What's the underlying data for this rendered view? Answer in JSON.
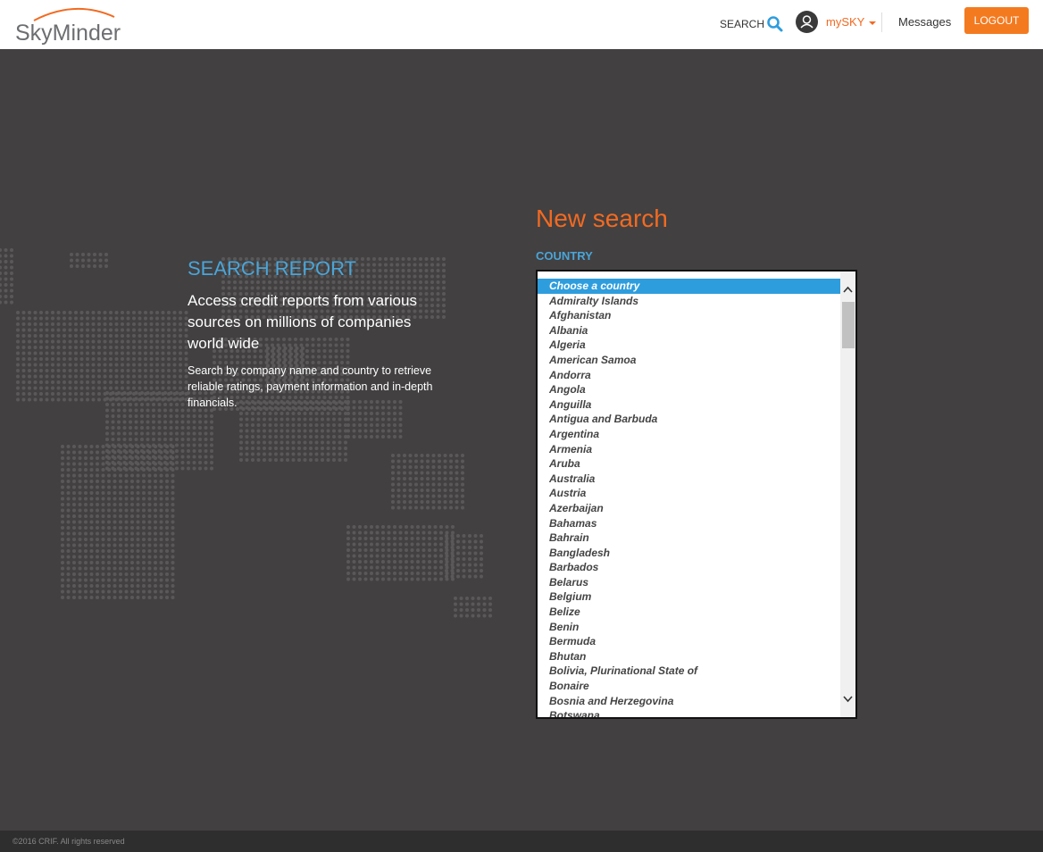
{
  "header": {
    "logo_text": "SkyMinder",
    "search_label": "SEARCH",
    "user_menu_label": "mySKY",
    "messages_label": "Messages",
    "logout_label": "LOGOUT"
  },
  "intro": {
    "heading": "SEARCH REPORT",
    "lead": "Access credit reports from various sources on millions of companies world wide",
    "description": "Search by company name and country to retrieve reliable ratings, payment information and in-depth financials."
  },
  "form": {
    "title": "New search",
    "country_label": "COUNTRY",
    "country_options": [
      "Choose a country",
      "Admiralty Islands",
      "Afghanistan",
      "Albania",
      "Algeria",
      "American Samoa",
      "Andorra",
      "Angola",
      "Anguilla",
      "Antigua and Barbuda",
      "Argentina",
      "Armenia",
      "Aruba",
      "Australia",
      "Austria",
      "Azerbaijan",
      "Bahamas",
      "Bahrain",
      "Bangladesh",
      "Barbados",
      "Belarus",
      "Belgium",
      "Belize",
      "Benin",
      "Bermuda",
      "Bhutan",
      "Bolivia, Plurinational State of",
      "Bonaire",
      "Bosnia and Herzegovina",
      "Botswana"
    ],
    "selected_index": 0
  },
  "footer": {
    "copyright": "©2016 CRIF. All rights reserved"
  },
  "colors": {
    "accent_orange": "#f26a21",
    "accent_blue": "#4aa5d8",
    "background": "#424041",
    "selection_blue": "#2e9ddd"
  }
}
